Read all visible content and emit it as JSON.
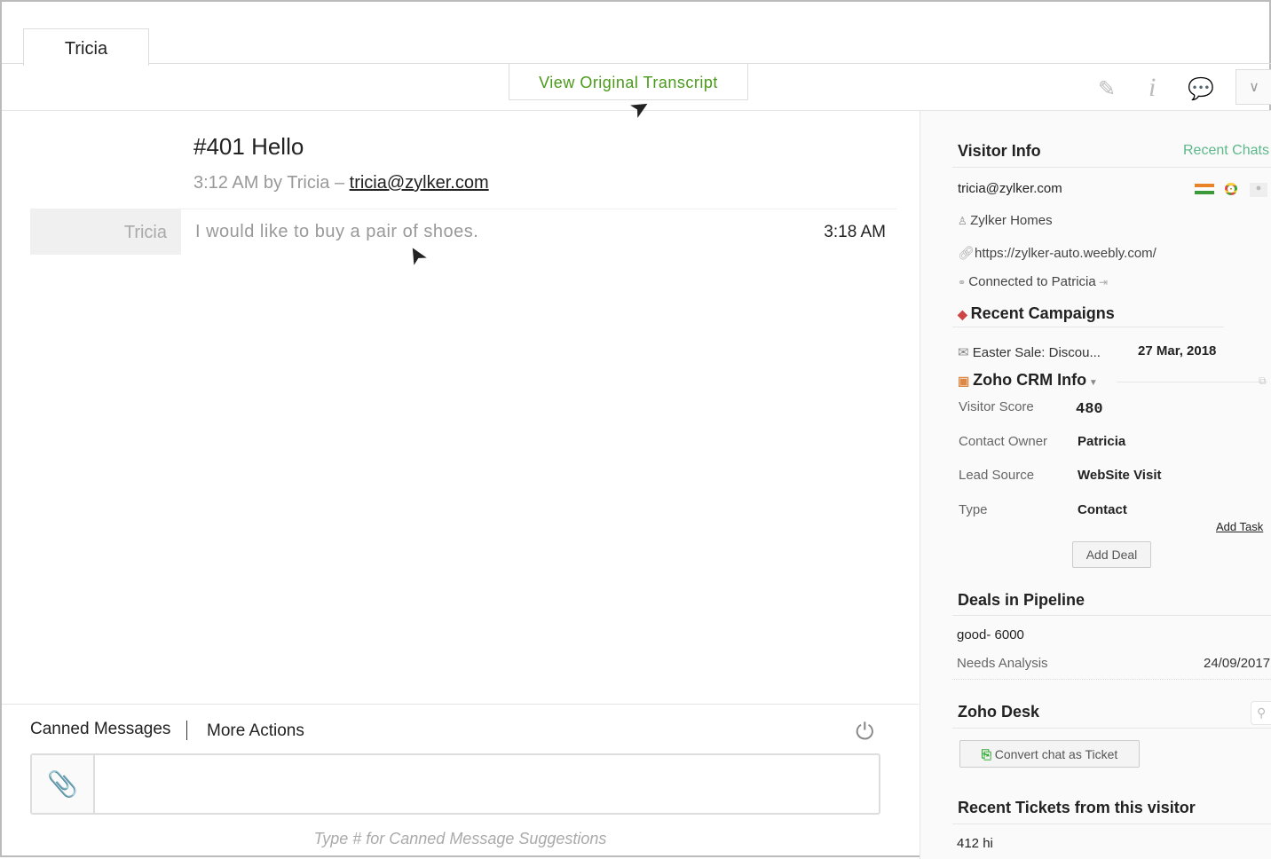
{
  "tab": "Tricia",
  "view_transcript": "View Original Transcript",
  "chat": {
    "title": "#401 Hello",
    "meta": "3:12 AM by Tricia – ",
    "email": "tricia@zylker.com",
    "messages": [
      {
        "sender": "Tricia",
        "text": "I would like to buy a pair of shoes.",
        "time": "3:18 AM"
      }
    ]
  },
  "footer": {
    "canned": "Canned Messages",
    "more": "More Actions",
    "hint": "Type # for Canned Message Suggestions",
    "input_value": ""
  },
  "visitor": {
    "title": "Visitor Info",
    "recent_chats": "Recent Chats",
    "email": "tricia@zylker.com",
    "company": "Zylker Homes",
    "url": "https://zylker-auto.weebly.com/",
    "connected": "Connected to Patricia"
  },
  "campaigns": {
    "title": "Recent Campaigns",
    "items": [
      {
        "name": "Easter Sale: Discou...",
        "date": "27 Mar, 2018"
      }
    ]
  },
  "crm": {
    "title": "Zoho CRM Info",
    "fields": [
      {
        "label": "Visitor Score",
        "value": "480"
      },
      {
        "label": "Contact Owner",
        "value": "Patricia"
      },
      {
        "label": "Lead Source",
        "value": "WebSite Visit"
      },
      {
        "label": "Type",
        "value": "Contact"
      }
    ],
    "add_task": "Add Task",
    "add_deal": "Add Deal"
  },
  "deals": {
    "title": "Deals in Pipeline",
    "name": "good- 6000",
    "stage": "Needs Analysis",
    "date": "24/09/2017"
  },
  "desk": {
    "title": "Zoho Desk",
    "convert": "Convert chat as Ticket",
    "recent_title": "Recent Tickets from this visitor",
    "tickets": [
      "412 hi"
    ]
  },
  "colors": {
    "accent": "#4a9a1a",
    "recent_chats": "#5cb88a"
  }
}
